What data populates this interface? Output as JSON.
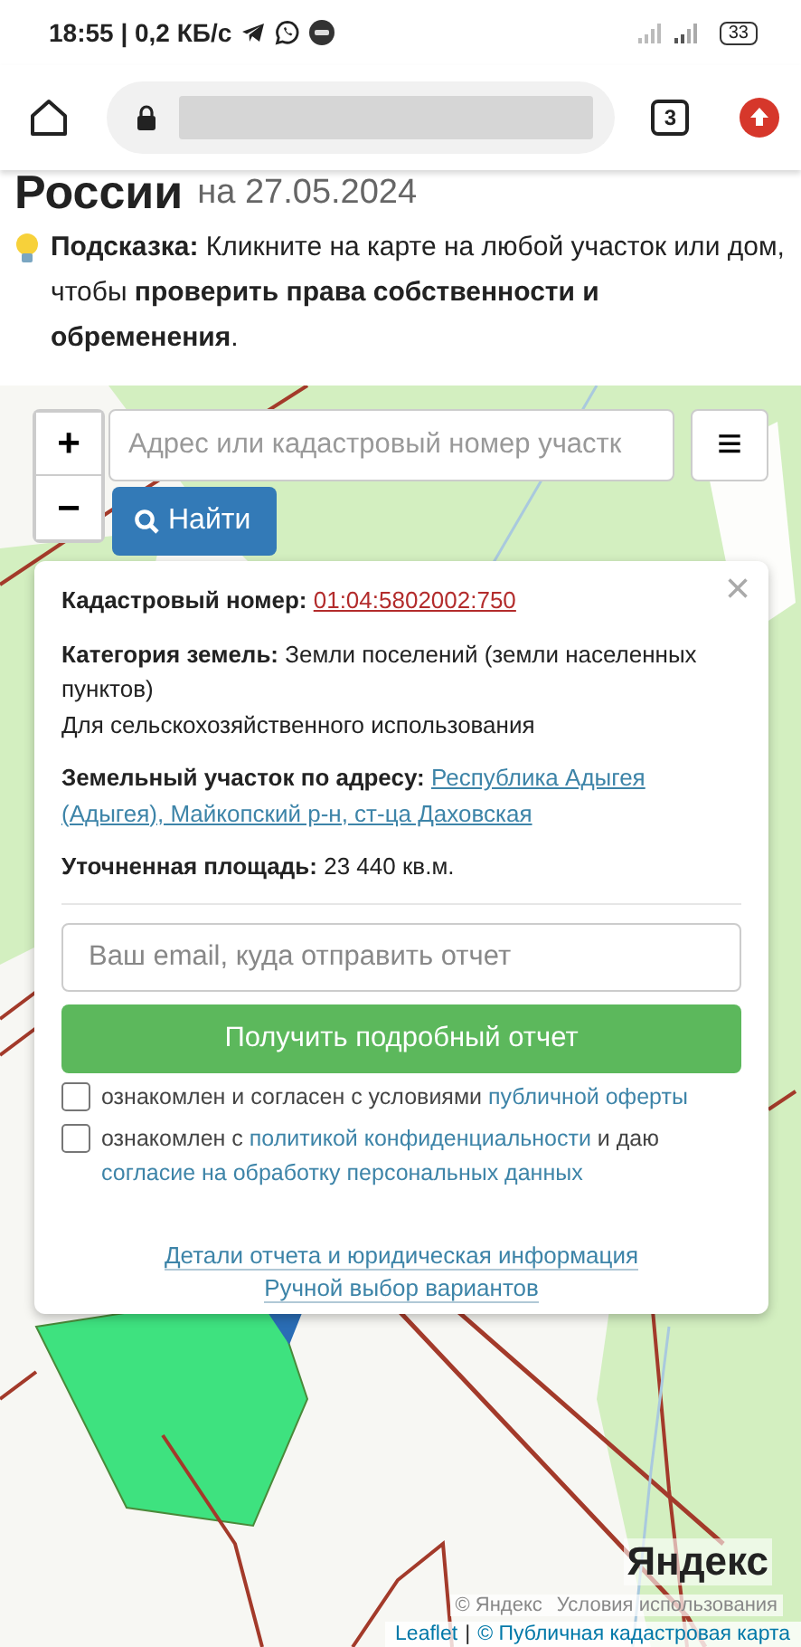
{
  "status_bar": {
    "time": "18:55 | 0,2 КБ/с",
    "battery": "33"
  },
  "browser": {
    "tab_count": "3"
  },
  "page": {
    "title": "России",
    "date": "на 27.05.2024",
    "hint": "**Подсказка:** Кликните на карте на любой участок или дом, чтобы **проверить права собственности и обременения**."
  },
  "map": {
    "zoom_in": "+",
    "zoom_out": "−",
    "search_placeholder": "Адрес или кадастровый номер участк",
    "menu": "≡",
    "find_button": "Найти",
    "popup": {
      "close": "×",
      "fields": [
        {
          "label": "Кадастровый номер:",
          "value": "01:04:5802002:750",
          "kind": "number_link"
        },
        {
          "label": "Категория земель:",
          "value": "Земли поселений (земли населенных пунктов)",
          "note": "Для сельскохозяйственного использования",
          "kind": "text"
        },
        {
          "label": "Земельный участок по адресу:",
          "value_lines": [
            "Республика Адыгея",
            "(Адыгея), Майкопский р-н, ст-ца Даховская"
          ],
          "kind": "address_link"
        },
        {
          "label": "Уточненная площадь:",
          "value": "23 440 кв.м.",
          "kind": "text"
        }
      ],
      "email_placeholder": "Ваш email, куда отправить отчет",
      "report_button": "Получить подробный отчет",
      "agreements": [
        {
          "checked": false,
          "parts": [
            {
              "kind": "text",
              "text": "ознакомлен и согласен с условиями "
            },
            {
              "kind": "link",
              "text": "публичной оферты"
            }
          ]
        },
        {
          "checked": false,
          "parts": [
            {
              "kind": "text",
              "text": "ознакомлен с "
            },
            {
              "kind": "link",
              "text": "политикой конфиденциальности"
            },
            {
              "kind": "text",
              "text": " и даю "
            },
            {
              "kind": "link",
              "text": "согласие на обработку персональных данных"
            }
          ]
        }
      ],
      "links": [
        "Детали отчета и юридическая информация",
        "Ручной выбор вариантов"
      ]
    },
    "yandex_logo": "Яндекс",
    "yandex_attribution": [
      "© Яндекс",
      "Условия использования"
    ],
    "attribution": [
      {
        "kind": "link",
        "text": "Leaflet"
      },
      {
        "kind": "separator",
        "text": "|"
      },
      {
        "kind": "link",
        "text": "© Публичная кадастровая карта"
      }
    ]
  }
}
